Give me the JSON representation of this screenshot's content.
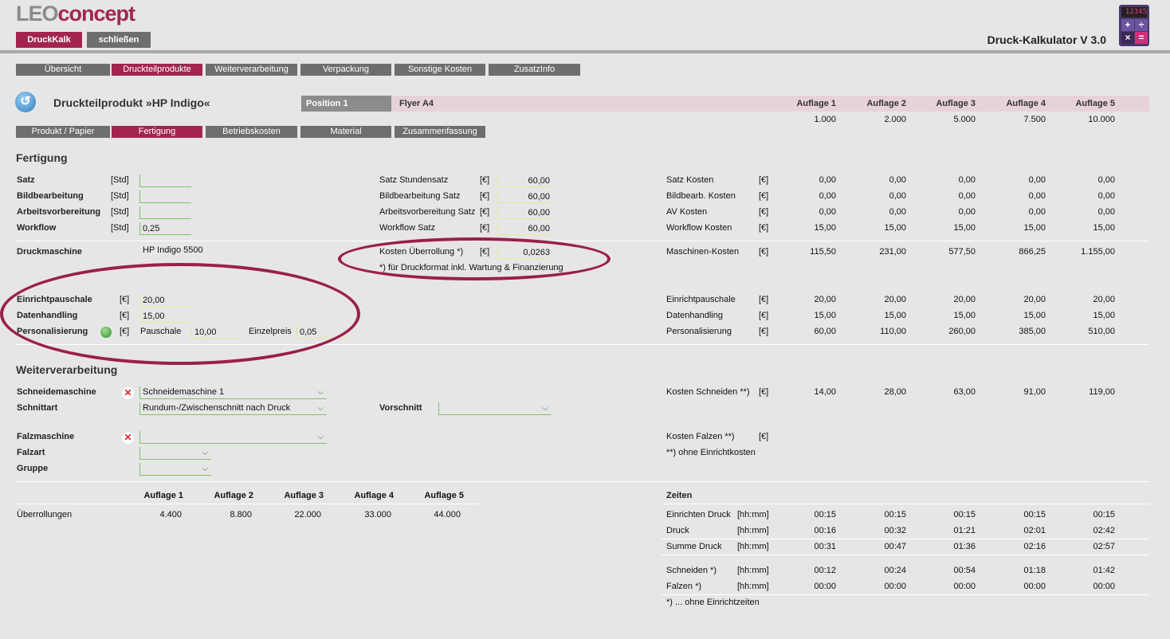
{
  "app": {
    "logo_a": "LEO",
    "logo_b": "concept",
    "btn_druckkalk": "DruckKalk",
    "btn_close": "schließen",
    "title": "Druck-Kalkulator V 3.0",
    "calc_display": "12345",
    "calc_keys": [
      "+",
      "÷",
      "×",
      "="
    ]
  },
  "tabs": [
    "Übersicht",
    "Druckteilprodukte",
    "Weiterverarbeitung",
    "Verpackung",
    "Sonstige Kosten",
    "ZusatzInfo"
  ],
  "subtabs": [
    "Produkt / Papier",
    "Fertigung",
    "Betriebskosten",
    "Material",
    "Zusammenfassung"
  ],
  "product": {
    "title": "Druckteilprodukt »HP Indigo«",
    "position": "Position 1",
    "name": "Flyer A4",
    "auflagen": [
      "Auflage 1",
      "Auflage 2",
      "Auflage 3",
      "Auflage 4",
      "Auflage 5"
    ],
    "mengen": [
      "1.000",
      "2.000",
      "5.000",
      "7.500",
      "10.000"
    ]
  },
  "fertigung": {
    "title": "Fertigung",
    "rows": [
      {
        "label": "Satz",
        "unit": "[Std]",
        "value": "",
        "rate_label": "Satz Stundensatz",
        "rate_unit": "[€]",
        "rate": "60,00",
        "cost_label": "Satz Kosten",
        "cost_unit": "[€]",
        "costs": [
          "0,00",
          "0,00",
          "0,00",
          "0,00",
          "0,00"
        ]
      },
      {
        "label": "Bildbearbeitung",
        "unit": "[Std]",
        "value": "",
        "rate_label": "Bildbearbeitung Satz",
        "rate_unit": "[€]",
        "rate": "60,00",
        "cost_label": "Bildbearb. Kosten",
        "cost_unit": "[€]",
        "costs": [
          "0,00",
          "0,00",
          "0,00",
          "0,00",
          "0,00"
        ]
      },
      {
        "label": "Arbeitsvorbereitung",
        "unit": "[Std]",
        "value": "",
        "rate_label": "Arbeitsvorbereitung Satz",
        "rate_unit": "[€]",
        "rate": "60,00",
        "cost_label": "AV Kosten",
        "cost_unit": "[€]",
        "costs": [
          "0,00",
          "0,00",
          "0,00",
          "0,00",
          "0,00"
        ]
      },
      {
        "label": "Workflow",
        "unit": "[Std]",
        "value": "0,25",
        "rate_label": "Workflow Satz",
        "rate_unit": "[€]",
        "rate": "60,00",
        "cost_label": "Workflow Kosten",
        "cost_unit": "[€]",
        "costs": [
          "15,00",
          "15,00",
          "15,00",
          "15,00",
          "15,00"
        ]
      }
    ],
    "druckmaschine_label": "Druckmaschine",
    "druckmaschine": "HP Indigo 5500",
    "ueberrollung_label": "Kosten Überrollung *)",
    "ueberrollung_unit": "[€]",
    "ueberrollung": "0,0263",
    "ueberrollung_note": "*) für Druckformat inkl. Wartung &  Finanzierung",
    "maschinen_label": "Maschinen-Kosten",
    "maschinen_unit": "[€]",
    "maschinen_costs": [
      "115,50",
      "231,00",
      "577,50",
      "866,25",
      "1.155,00"
    ],
    "einricht_label": "Einrichtpauschale",
    "einricht_unit": "[€]",
    "einricht": "20,00",
    "daten_label": "Datenhandling",
    "daten_unit": "[€]",
    "daten": "15,00",
    "pers_label": "Personalisierung",
    "pers_unit": "[€]",
    "pauschale_label": "Pauschale",
    "pauschale": "10,00",
    "einzelpreis_label": "Einzelpreis",
    "einzelpreis": "0,05",
    "right_rows": [
      {
        "label": "Einrichtpauschale",
        "unit": "[€]",
        "costs": [
          "20,00",
          "20,00",
          "20,00",
          "20,00",
          "20,00"
        ]
      },
      {
        "label": "Datenhandling",
        "unit": "[€]",
        "costs": [
          "15,00",
          "15,00",
          "15,00",
          "15,00",
          "15,00"
        ]
      },
      {
        "label": "Personalisierung",
        "unit": "[€]",
        "costs": [
          "60,00",
          "110,00",
          "260,00",
          "385,00",
          "510,00"
        ]
      }
    ]
  },
  "weiter": {
    "title": "Weiterverarbeitung",
    "schneide_label": "Schneidemaschine",
    "schneide": "Schneidemaschine 1",
    "schnittart_label": "Schnittart",
    "schnittart": "Rundum-/Zwischenschnitt nach Druck",
    "vorschnitt_label": "Vorschnitt",
    "vorschnitt": "",
    "kosten_schneiden_label": "Kosten Schneiden **)",
    "kosten_schneiden_unit": "[€]",
    "kosten_schneiden": [
      "14,00",
      "28,00",
      "63,00",
      "91,00",
      "119,00"
    ],
    "falz_label": "Falzmaschine",
    "falz": "",
    "falzart_label": "Falzart",
    "gruppe_label": "Gruppe",
    "kosten_falzen_label": "Kosten Falzen **)",
    "kosten_falzen_unit": "[€]",
    "note": "**) ohne Einrichtkosten"
  },
  "ueberroll": {
    "headers": [
      "Auflage 1",
      "Auflage 2",
      "Auflage 3",
      "Auflage 4",
      "Auflage 5"
    ],
    "label": "Überrollungen",
    "values": [
      "4.400",
      "8.800",
      "22.000",
      "33.000",
      "44.000"
    ]
  },
  "zeiten": {
    "title": "Zeiten",
    "rows": [
      {
        "label": "Einrichten Druck",
        "unit": "[hh:mm]",
        "values": [
          "00:15",
          "00:15",
          "00:15",
          "00:15",
          "00:15"
        ]
      },
      {
        "label": "Druck",
        "unit": "[hh:mm]",
        "values": [
          "00:16",
          "00:32",
          "01:21",
          "02:01",
          "02:42"
        ]
      },
      {
        "label": "Summe Druck",
        "unit": "[hh:mm]",
        "values": [
          "00:31",
          "00:47",
          "01:36",
          "02:16",
          "02:57"
        ]
      },
      {
        "label": "Schneiden *)",
        "unit": "[hh:mm]",
        "values": [
          "00:12",
          "00:24",
          "00:54",
          "01:18",
          "01:42"
        ]
      },
      {
        "label": "Falzen *)",
        "unit": "[hh:mm]",
        "values": [
          "00:00",
          "00:00",
          "00:00",
          "00:00",
          "00:00"
        ]
      }
    ],
    "note": "*) ... ohne Einrichtzeiten"
  }
}
